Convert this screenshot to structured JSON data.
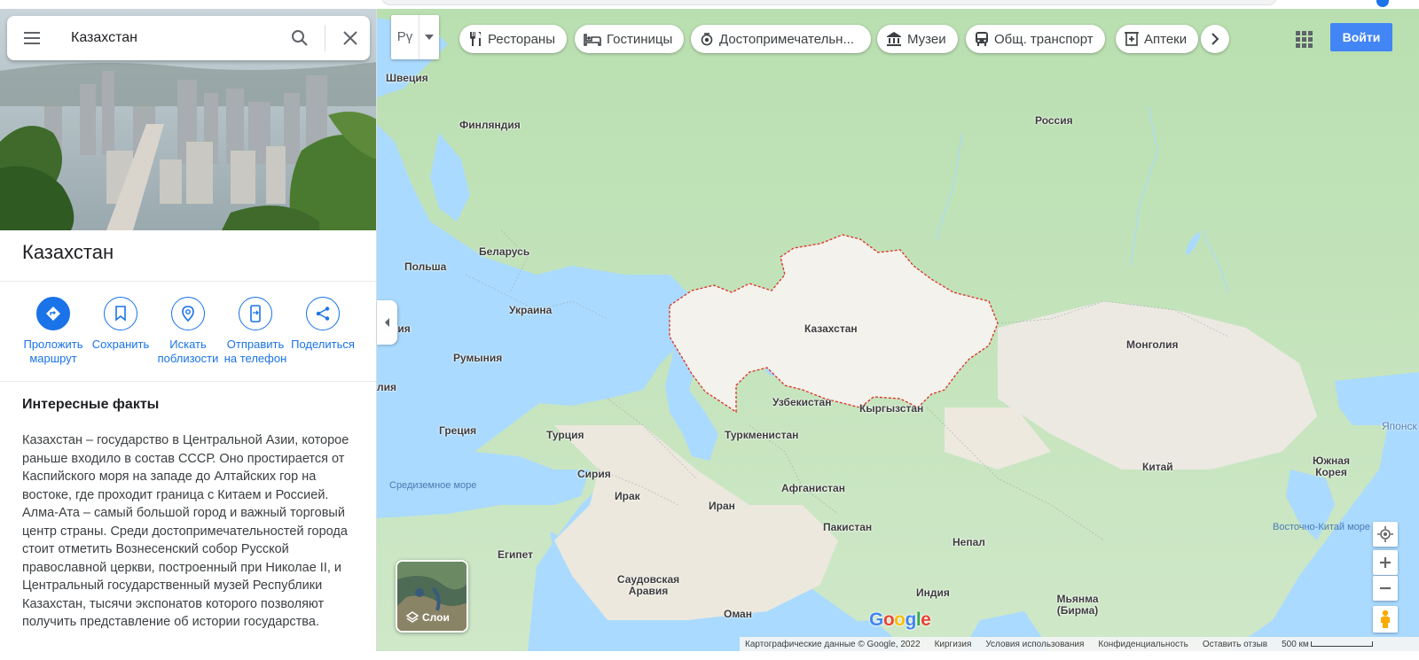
{
  "search": {
    "value": "Казахстан"
  },
  "place": {
    "title": "Казахстан",
    "actions": [
      {
        "name": "directions",
        "label": "Проложить маршрут"
      },
      {
        "name": "save",
        "label": "Сохранить"
      },
      {
        "name": "nearby",
        "label": "Искать поблизости"
      },
      {
        "name": "send-to-phone",
        "label": "Отправить на телефон"
      },
      {
        "name": "share",
        "label": "Поделиться"
      }
    ],
    "facts_heading": "Интересные факты",
    "facts_text": "Казахстан – государство в Центральной Азии, которое раньше входило в состав СССР. Оно простирается от Каспийского моря на западе до Алтайских гор на востоке, где проходит граница с Китаем и Россией. Алма-Ата – самый большой город и важный торговый центр страны. Среди достопримечательностей города стоит отметить Вознесенский собор Русской православной церкви, построенный при Николае II, и Центральный государственный музей Республики Казахстан, тысячи экспонатов которого позволяют получить представление об истории государства."
  },
  "toolbar": {
    "language": "Рү",
    "chips": [
      {
        "name": "restaurants",
        "label": "Рестораны",
        "icon": "fork-knife-icon"
      },
      {
        "name": "hotels",
        "label": "Гостиницы",
        "icon": "bed-icon"
      },
      {
        "name": "attractions",
        "label": "Достопримечательн...",
        "icon": "camera-icon"
      },
      {
        "name": "museums",
        "label": "Музеи",
        "icon": "museum-icon"
      },
      {
        "name": "transit",
        "label": "Общ. транспорт",
        "icon": "bus-icon"
      },
      {
        "name": "pharmacies",
        "label": "Аптеки",
        "icon": "pharmacy-icon"
      }
    ],
    "signin_label": "Войти"
  },
  "map": {
    "labels": [
      {
        "text": "Швеция"
      },
      {
        "text": "Финляндия"
      },
      {
        "text": "Россия"
      },
      {
        "text": "Беларусь"
      },
      {
        "text": "Польша"
      },
      {
        "text": "Украина"
      },
      {
        "text": "рия"
      },
      {
        "text": "Румыния"
      },
      {
        "text": "лия"
      },
      {
        "text": "Казахстан"
      },
      {
        "text": "Монголия"
      },
      {
        "text": "Узбекистан"
      },
      {
        "text": "Кыргызстан"
      },
      {
        "text": "Греция"
      },
      {
        "text": "Турция"
      },
      {
        "text": "Туркменистан"
      },
      {
        "text": "Сирия"
      },
      {
        "text": "Ирак"
      },
      {
        "text": "Иран"
      },
      {
        "text": "Афганистан"
      },
      {
        "text": "Китай"
      },
      {
        "text": "Пакистан"
      },
      {
        "text": "Египет"
      },
      {
        "text": "Саудовская Аравия"
      },
      {
        "text": "Непал"
      },
      {
        "text": "Индия"
      },
      {
        "text": "Оман"
      },
      {
        "text": "Мьянма (Бирма)"
      },
      {
        "text": "Южная Корея"
      },
      {
        "text": "Японск"
      }
    ],
    "water_labels": [
      {
        "text": "Средиземное море"
      },
      {
        "text": "Восточно-Китай море"
      }
    ],
    "layers_label": "Слои",
    "logo": "Google",
    "colors": {
      "land": "#cfe8c8",
      "desert": "#f1efe8",
      "water": "#aadaff",
      "border": "#d93025",
      "accent": "#1a73e8"
    }
  },
  "footer": {
    "attribution": "Картографические данные © Google, 2022",
    "region": "Киргизия",
    "terms": "Условия использования",
    "privacy": "Конфиденциальность",
    "feedback": "Оставить отзыв",
    "scale": "500 км"
  }
}
